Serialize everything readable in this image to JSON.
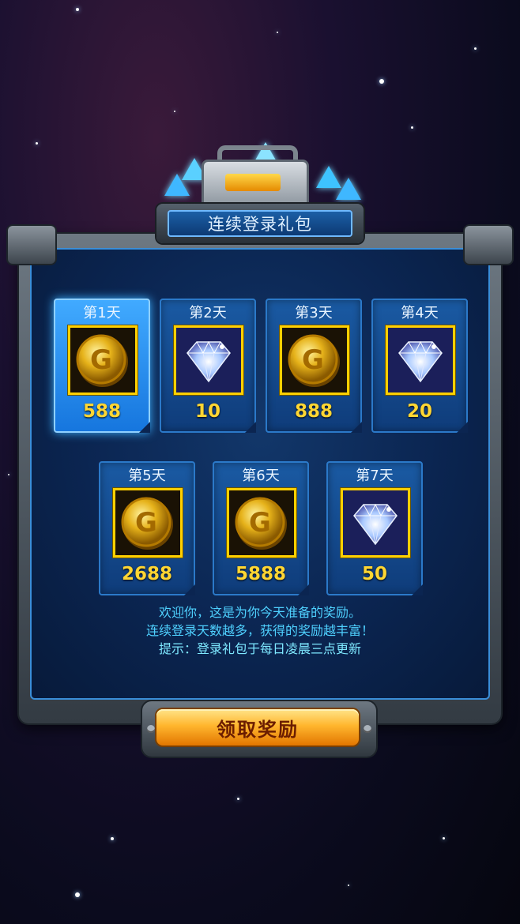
{
  "title": "连续登录礼包",
  "days": [
    {
      "label": "第1天",
      "reward": "coin",
      "amount": "588",
      "active": true
    },
    {
      "label": "第2天",
      "reward": "diamond",
      "amount": "10",
      "active": false
    },
    {
      "label": "第3天",
      "reward": "coin",
      "amount": "888",
      "active": false
    },
    {
      "label": "第4天",
      "reward": "diamond",
      "amount": "20",
      "active": false
    },
    {
      "label": "第5天",
      "reward": "coin",
      "amount": "2688",
      "active": false
    },
    {
      "label": "第6天",
      "reward": "coin",
      "amount": "5888",
      "active": false
    },
    {
      "label": "第7天",
      "reward": "diamond",
      "amount": "50",
      "active": false
    }
  ],
  "messages": {
    "line1": "欢迎你，这是为你今天准备的奖励。",
    "line2": "连续登录天数越多，获得的奖励越丰富！",
    "tip": "提示：登录礼包于每日凌晨三点更新"
  },
  "claim_button": "领取奖励",
  "colors": {
    "active_card": "#1f8ef0",
    "card": "#12468a",
    "amount": "#ffd633",
    "message": "#4fd1ff",
    "button": "#ffb62e"
  }
}
